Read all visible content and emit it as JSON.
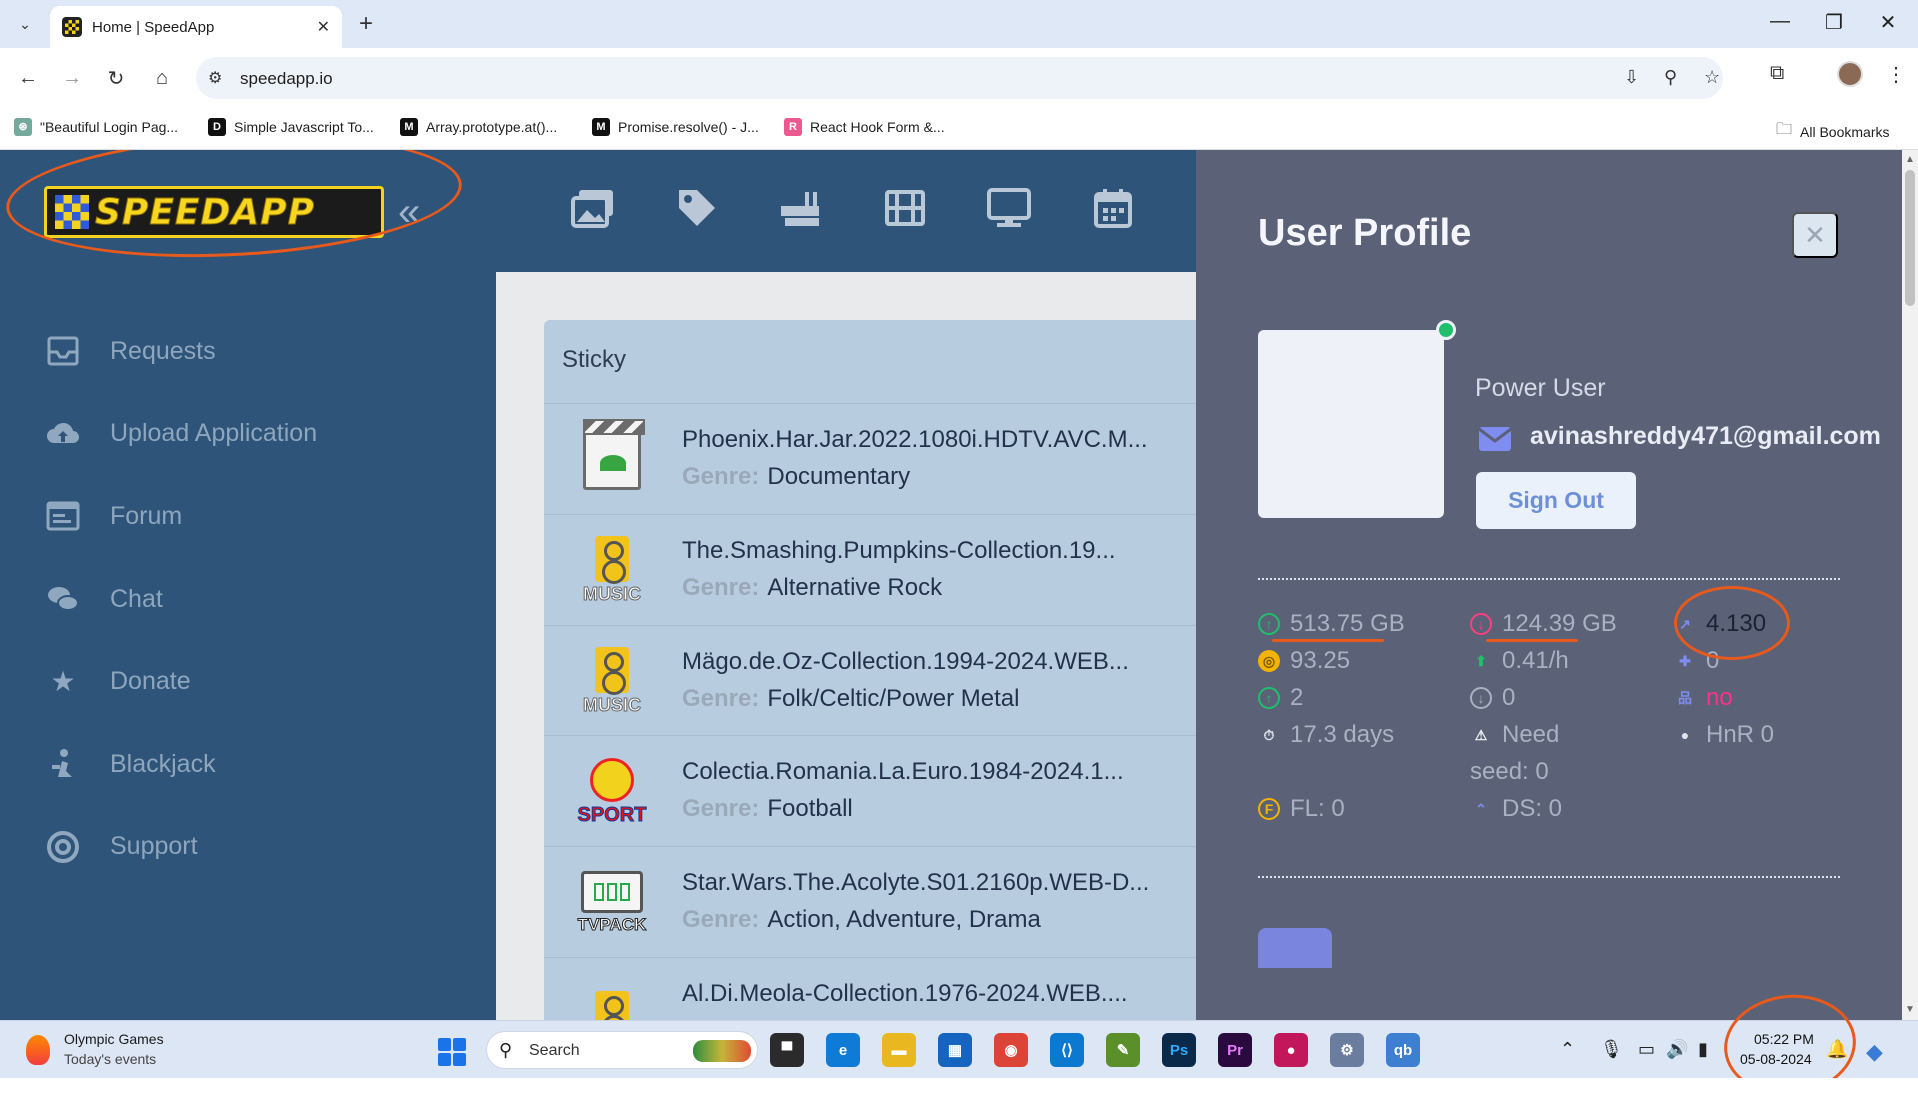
{
  "browser": {
    "tab_title": "Home | SpeedApp",
    "url": "speedapp.io",
    "bookmarks": [
      {
        "label": "\"Beautiful Login Pag..."
      },
      {
        "label": "Simple Javascript To..."
      },
      {
        "label": "Array.prototype.at()..."
      },
      {
        "label": "Promise.resolve() - J..."
      },
      {
        "label": "React Hook Form &..."
      }
    ],
    "all_bookmarks": "All Bookmarks"
  },
  "site": {
    "logo_text": "SPEEDAPP",
    "collapse_glyph": "«"
  },
  "sidebar": {
    "items": [
      {
        "label": "Requests",
        "icon": "inbox-icon"
      },
      {
        "label": "Upload Application",
        "icon": "cloud-upload-icon"
      },
      {
        "label": "Forum",
        "icon": "forum-icon"
      },
      {
        "label": "Chat",
        "icon": "chat-icon"
      },
      {
        "label": "Donate",
        "icon": "star-icon"
      },
      {
        "label": "Blackjack",
        "icon": "blackjack-icon"
      },
      {
        "label": "Support",
        "icon": "support-icon"
      }
    ]
  },
  "topnav": {
    "icons": [
      "images-icon",
      "tag-icon",
      "gun-icon",
      "film-icon",
      "monitor-icon",
      "calendar-icon"
    ]
  },
  "sticky": {
    "title": "Sticky",
    "genre_label": "Genre:",
    "rows": [
      {
        "name": "Phoenix.Har.Jar.2022.1080i.HDTV.AVC.M...",
        "genre": "Documentary",
        "thumb": "doc"
      },
      {
        "name": "The.Smashing.Pumpkins-Collection.19...",
        "genre": "Alternative Rock",
        "thumb": "music"
      },
      {
        "name": "Mägo.de.Oz-Collection.1994-2024.WEB...",
        "genre": "Folk/Celtic/Power Metal",
        "thumb": "music"
      },
      {
        "name": "Colectia.Romania.La.Euro.1984-2024.1...",
        "genre": "Football",
        "thumb": "sport"
      },
      {
        "name": "Star.Wars.The.Acolyte.S01.2160p.WEB-D...",
        "genre": "Action, Adventure, Drama",
        "thumb": "tv"
      },
      {
        "name": "Al.Di.Meola-Collection.1976-2024.WEB....",
        "genre": "",
        "thumb": "music"
      }
    ],
    "thumb_labels": {
      "music": "MUSIC",
      "sport": "SPORT",
      "tv": "TVPACK"
    }
  },
  "profile": {
    "title": "User Profile",
    "close_glyph": "✕",
    "role": "Power User",
    "email": "avinashreddy471@gmail.com",
    "sign_out": "Sign Out",
    "stats": {
      "uploaded": "513.75 GB",
      "downloaded": "124.39 GB",
      "ratio": "4.130",
      "bonus": "93.25",
      "bonus_rate": "0.41/h",
      "invites": "0",
      "seeding": "2",
      "leeching": "0",
      "connectable": "no",
      "seed_time": "17.3 days",
      "need_seed_label": "Need",
      "need_seed_value": "seed: 0",
      "hnr": "HnR 0",
      "fl": "FL: 0",
      "ds": "DS: 0"
    }
  },
  "taskbar": {
    "weather_title": "Olympic Games",
    "weather_sub": "Today's events",
    "search_placeholder": "Search",
    "time": "05:22 PM",
    "date": "05-08-2024",
    "apps": [
      {
        "label": "▀",
        "color": "#2b2b2b"
      },
      {
        "label": "e",
        "color": "#0f7bd6"
      },
      {
        "label": "▬",
        "color": "#e9b821"
      },
      {
        "label": "▦",
        "color": "#1565c0"
      },
      {
        "label": "◉",
        "color": "#db4437"
      },
      {
        "label": "⟨⟩",
        "color": "#0b79d0"
      },
      {
        "label": "✎",
        "color": "#5a8f29"
      },
      {
        "label": "Ps",
        "color": "#0b2a4a"
      },
      {
        "label": "Pr",
        "color": "#2a0a3f"
      },
      {
        "label": "●",
        "color": "#c2185b"
      },
      {
        "label": "⚙",
        "color": "#6a7d9e"
      },
      {
        "label": "qb",
        "color": "#3d7fd1"
      }
    ]
  }
}
